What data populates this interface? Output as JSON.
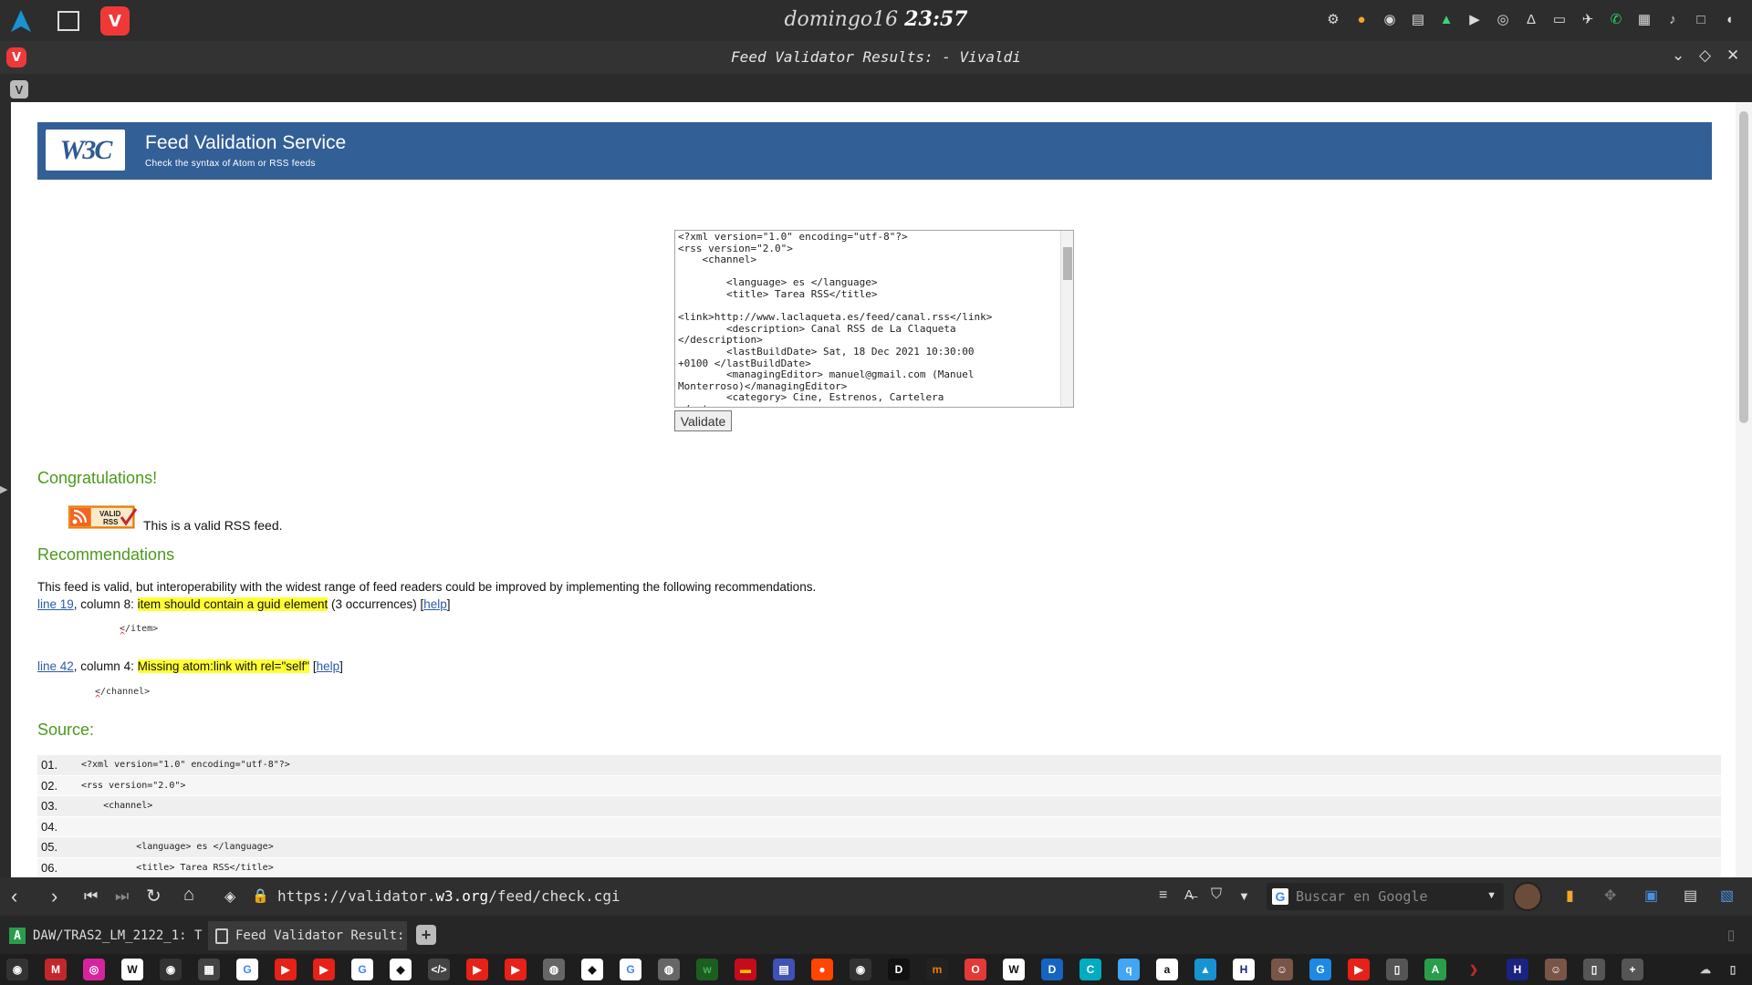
{
  "system": {
    "user": "domingo16",
    "time": "23:57"
  },
  "window": {
    "title": "Feed Validator Results: - Vivaldi"
  },
  "banner": {
    "logo": "W3C",
    "title": "Feed Validation Service",
    "subtitle": "Check the syntax of Atom or RSS feeds"
  },
  "form": {
    "xml": "<?xml version=\"1.0\" encoding=\"utf-8\"?>\n<rss version=\"2.0\">\n    <channel>\n\n        <language> es </language>\n        <title> Tarea RSS</title>\n\n<link>http://www.laclaqueta.es/feed/canal.rss</link>\n        <description> Canal RSS de La Claqueta\n</description>\n        <lastBuildDate> Sat, 18 Dec 2021 10:30:00\n+0100 </lastBuildDate>\n        <managingEditor> manuel@gmail.com (Manuel\nMonterroso)</managingEditor>\n        <category> Cine, Estrenos, Cartelera\n</category>",
    "validate_label": "Validate"
  },
  "result": {
    "congrats": "Congratulations!",
    "badge_line1": "VALID",
    "badge_line2": "RSS",
    "valid_text": "This is a valid RSS feed.",
    "recommendations_heading": "Recommendations",
    "intro": "This feed is valid, but interoperability with the widest range of feed readers could be improved by implementing the following recommendations.",
    "items": [
      {
        "line_link": "line 19",
        "column": ", column 8: ",
        "message": "item should contain a guid element",
        "extra": " (3 occurrences) [",
        "help": "help",
        "close": "]",
        "snippet": "</item>",
        "caret": "^"
      },
      {
        "line_link": "line 42",
        "column": ", column 4: ",
        "message": "Missing atom:link with rel=\"self\"",
        "extra": " [",
        "help": "help",
        "close": "]",
        "snippet": "</channel>",
        "caret": "^"
      }
    ],
    "source_heading": "Source:",
    "source_lines": [
      {
        "num": "01.",
        "code": "<?xml version=\"1.0\" encoding=\"utf-8\"?>"
      },
      {
        "num": "02.",
        "code": "<rss version=\"2.0\">"
      },
      {
        "num": "03.",
        "code": "    <channel>"
      },
      {
        "num": "04.",
        "code": ""
      },
      {
        "num": "05.",
        "code": "          <language> es </language>"
      },
      {
        "num": "06.",
        "code": "          <title> Tarea RSS</title>"
      }
    ]
  },
  "addressbar": {
    "url_prefix": "https://validator.",
    "url_domain": "w3.org",
    "url_suffix": "/feed/check.cgi",
    "search_placeholder": "Buscar en Google"
  },
  "tabs": [
    {
      "label": "DAW/TRAS2_LM_2122_1: T",
      "active": false
    },
    {
      "label": "Feed Validator Result:",
      "active": true
    }
  ],
  "colors": {
    "banner": "#335f97",
    "heading_green": "#4b9a1c",
    "highlight": "#ffff33",
    "vivaldi_red": "#ef3939"
  }
}
